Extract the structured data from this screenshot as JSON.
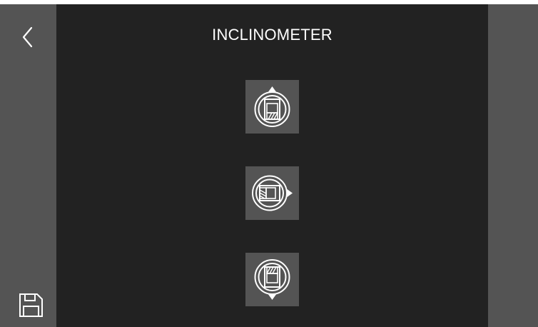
{
  "header": {
    "title": "INCLINOMETER"
  },
  "nav": {
    "back_icon": "chevron-left-icon",
    "save_icon": "floppy-disk-icon"
  },
  "orientation_buttons": [
    {
      "id": "up",
      "icon": "sensor-orientation-up-icon"
    },
    {
      "id": "side",
      "icon": "sensor-orientation-side-icon"
    },
    {
      "id": "down",
      "icon": "sensor-orientation-down-icon"
    }
  ],
  "colors": {
    "background": "#222222",
    "side_panel": "#545454",
    "button_bg": "#545454",
    "foreground": "#ffffff"
  }
}
